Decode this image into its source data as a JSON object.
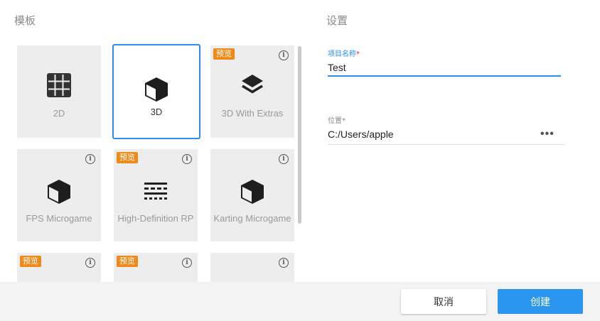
{
  "templates": {
    "title": "模板",
    "cards": [
      {
        "label": "2D",
        "icon": "grid-icon",
        "badge": "",
        "info": false,
        "selected": false
      },
      {
        "label": "3D",
        "icon": "cube-icon",
        "badge": "",
        "info": false,
        "selected": true
      },
      {
        "label": "3D With Extras",
        "icon": "layers-icon",
        "badge": "预览",
        "info": true,
        "selected": false
      },
      {
        "label": "FPS Microgame",
        "icon": "cube-icon",
        "badge": "",
        "info": true,
        "selected": false
      },
      {
        "label": "High-Definition RP",
        "icon": "hdrp-icon",
        "badge": "预览",
        "info": true,
        "selected": false
      },
      {
        "label": "Karting Microgame",
        "icon": "cube-icon",
        "badge": "",
        "info": true,
        "selected": false
      },
      {
        "label": "",
        "icon": "",
        "badge": "预览",
        "info": true,
        "selected": false
      },
      {
        "label": "",
        "icon": "",
        "badge": "预览",
        "info": true,
        "selected": false
      },
      {
        "label": "",
        "icon": "",
        "badge": "",
        "info": true,
        "selected": false
      }
    ]
  },
  "settings": {
    "title": "设置",
    "project_name_label": "项目名称",
    "project_name_value": "Test",
    "location_label": "位置",
    "location_value": "C:/Users/apple",
    "required_mark": "*",
    "browse_label": "•••"
  },
  "info_glyph": "i",
  "footer": {
    "cancel_label": "取消",
    "create_label": "创建"
  },
  "colors": {
    "accent": "#2a8ff0",
    "badge": "#ef8a1a",
    "card_bg": "#ededed"
  }
}
